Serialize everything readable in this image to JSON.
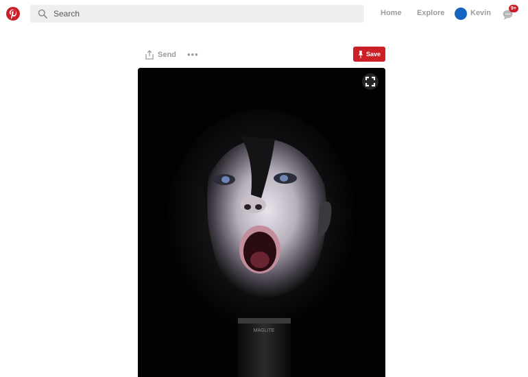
{
  "header": {
    "logo_icon": "pinterest-logo",
    "search": {
      "placeholder": "Search",
      "icon": "search-icon"
    },
    "nav": {
      "home": "Home",
      "explore": "Explore",
      "user_name": "Kevin"
    },
    "messages": {
      "icon": "chat-bubbles-icon",
      "badge": "9+"
    }
  },
  "pin": {
    "send_label": "Send",
    "more_label": "•••",
    "save_label": "Save",
    "image_alt": "Child lit from below by a flashlight",
    "flashlight_text": "MAGLITE"
  },
  "colors": {
    "brand": "#cb2027",
    "avatar": "#1565c0"
  }
}
